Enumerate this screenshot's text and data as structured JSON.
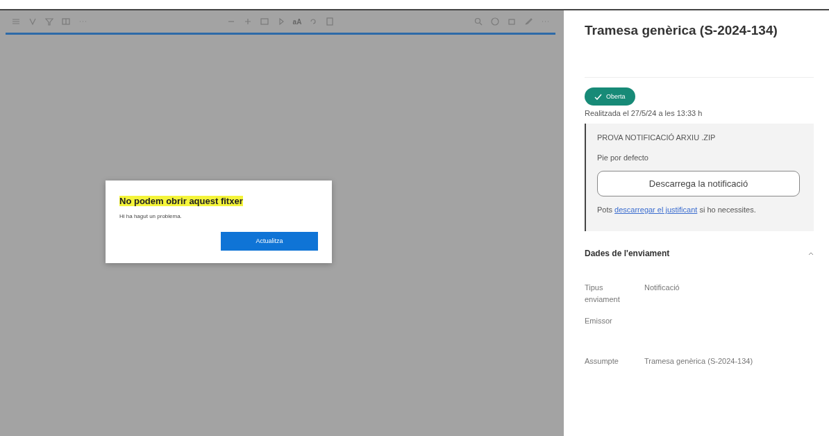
{
  "viewer": {
    "toolbar": {
      "text_tool": "aA"
    },
    "dialog": {
      "title": "No podem obrir aquest fitxer",
      "message": "Hi ha hagut un problema.",
      "button": "Actualitza"
    }
  },
  "panel": {
    "title": "Tramesa genèrica (S-2024-134)",
    "status": {
      "label": "Oberta"
    },
    "date": "Realitzada el 27/5/24 a les 13:33 h",
    "notification": {
      "name": "PROVA NOTIFICACIÓ ARXIU .ZIP",
      "footer": "Pie por defecto",
      "button": "Descarrega la notificació",
      "note_before": "Pots",
      "note_link": "descarregar el justificant",
      "note_after": "si ho necessites."
    },
    "section": {
      "title": "Dades de l'enviament",
      "expanded": true,
      "fields": [
        {
          "label": "Tipus enviament",
          "value": "Notificació"
        },
        {
          "label": "Emissor"
        },
        {
          "label": "Assumpte",
          "value": "Tramesa genèrica (S-2024-134)"
        }
      ]
    }
  }
}
